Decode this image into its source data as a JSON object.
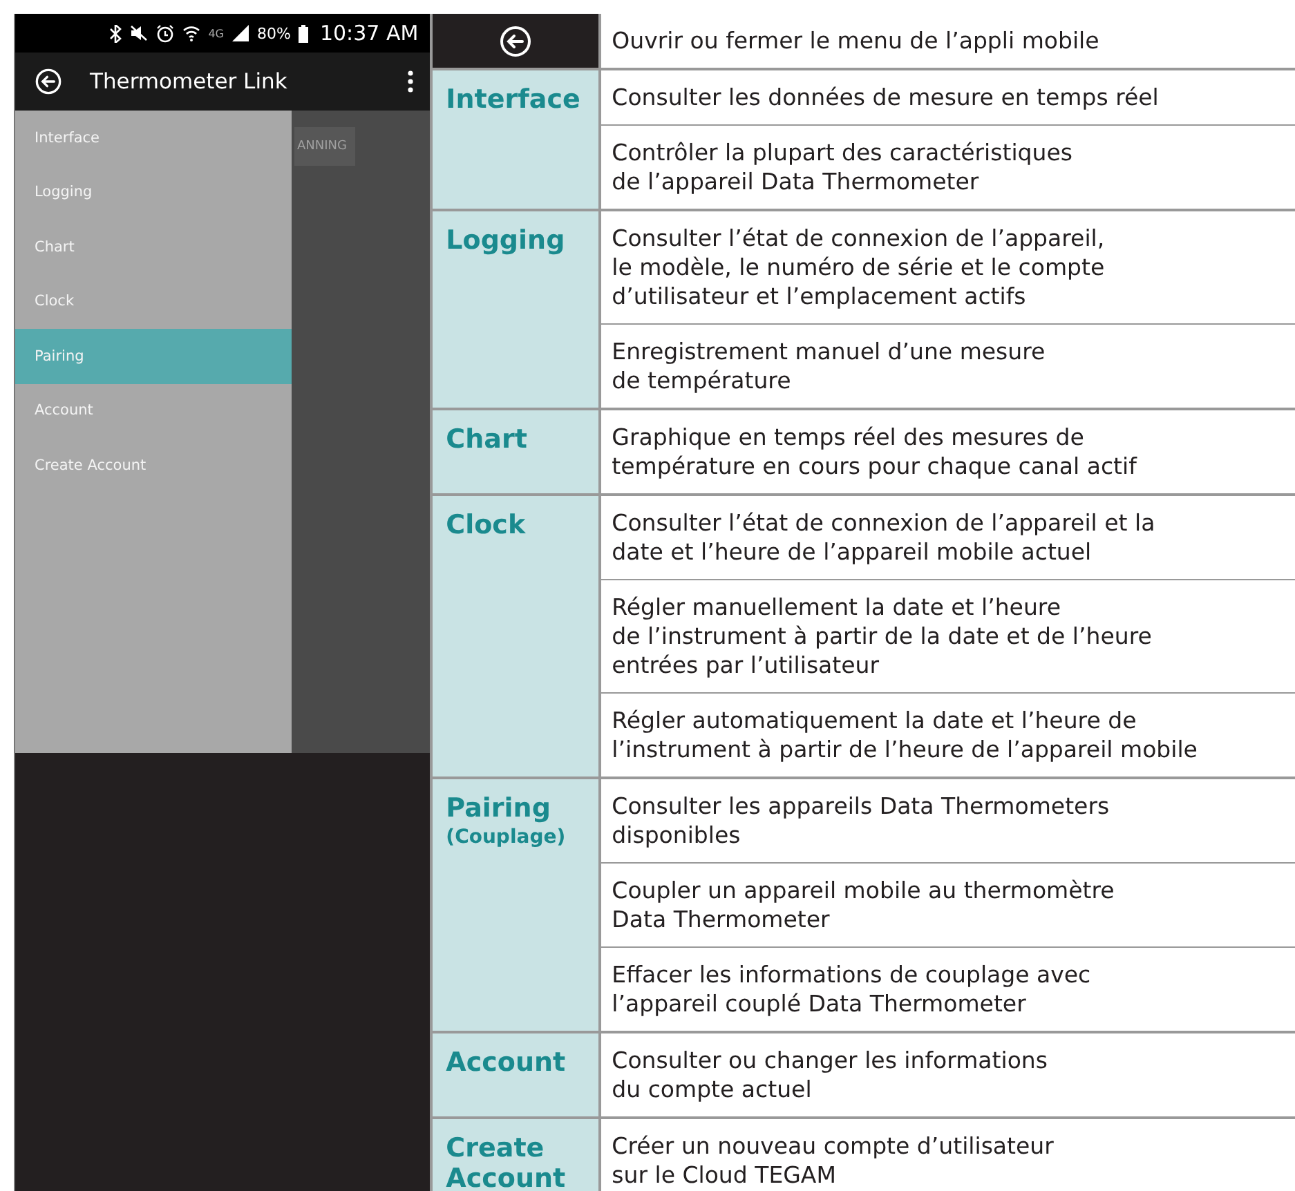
{
  "phone": {
    "status_bar": {
      "network": "4G",
      "battery": "80%",
      "time": "10:37 AM"
    },
    "app_bar": {
      "title": "Thermometer Link"
    },
    "background_button": "ANNING",
    "drawer": {
      "items": [
        {
          "label": "Interface",
          "selected": false
        },
        {
          "label": "Logging",
          "selected": false
        },
        {
          "label": "Chart",
          "selected": false
        },
        {
          "label": "Clock",
          "selected": false
        },
        {
          "label": "Pairing",
          "selected": true
        },
        {
          "label": "Account",
          "selected": false
        },
        {
          "label": "Create Account",
          "selected": false
        }
      ]
    }
  },
  "table": {
    "header_description": "Ouvrir ou fermer le menu de l’appli mobile",
    "groups": [
      {
        "label": "Interface",
        "descriptions": [
          "Consulter les données de mesure en temps réel",
          "Contrôler la plupart des caractéristiques\nde l’appareil Data Thermometer"
        ]
      },
      {
        "label": "Logging",
        "descriptions": [
          "Consulter l’état de connexion de l’appareil,\nle modèle, le numéro de série et le compte\nd’utilisateur et l’emplacement actifs",
          "Enregistrement manuel d’une mesure\nde température"
        ]
      },
      {
        "label": "Chart",
        "descriptions": [
          "Graphique en temps réel des mesures de\ntempérature en cours pour chaque canal actif"
        ]
      },
      {
        "label": "Clock",
        "descriptions": [
          "Consulter l’état de connexion de l’appareil et la\ndate et l’heure de l’appareil mobile actuel",
          "Régler manuellement la date et l’heure\nde l’instrument à partir de la date et de l’heure\nentrées par l’utilisateur",
          "Régler automatiquement la date et l’heure de\nl’instrument à partir de l’heure de l’appareil mobile"
        ]
      },
      {
        "label": "Pairing",
        "sublabel": "(Couplage)",
        "descriptions": [
          "Consulter les appareils Data Thermometers\ndisponibles",
          "Coupler un appareil mobile au thermomètre\nData Thermometer",
          "Effacer les informations de couplage avec\nl’appareil couplé Data Thermometer"
        ]
      },
      {
        "label": "Account",
        "descriptions": [
          "Consulter ou changer les informations\ndu compte actuel"
        ]
      },
      {
        "label": "Create Account",
        "descriptions": [
          "Créer un nouveau compte d’utilisateur\nsur le Cloud TEGAM"
        ]
      }
    ]
  }
}
